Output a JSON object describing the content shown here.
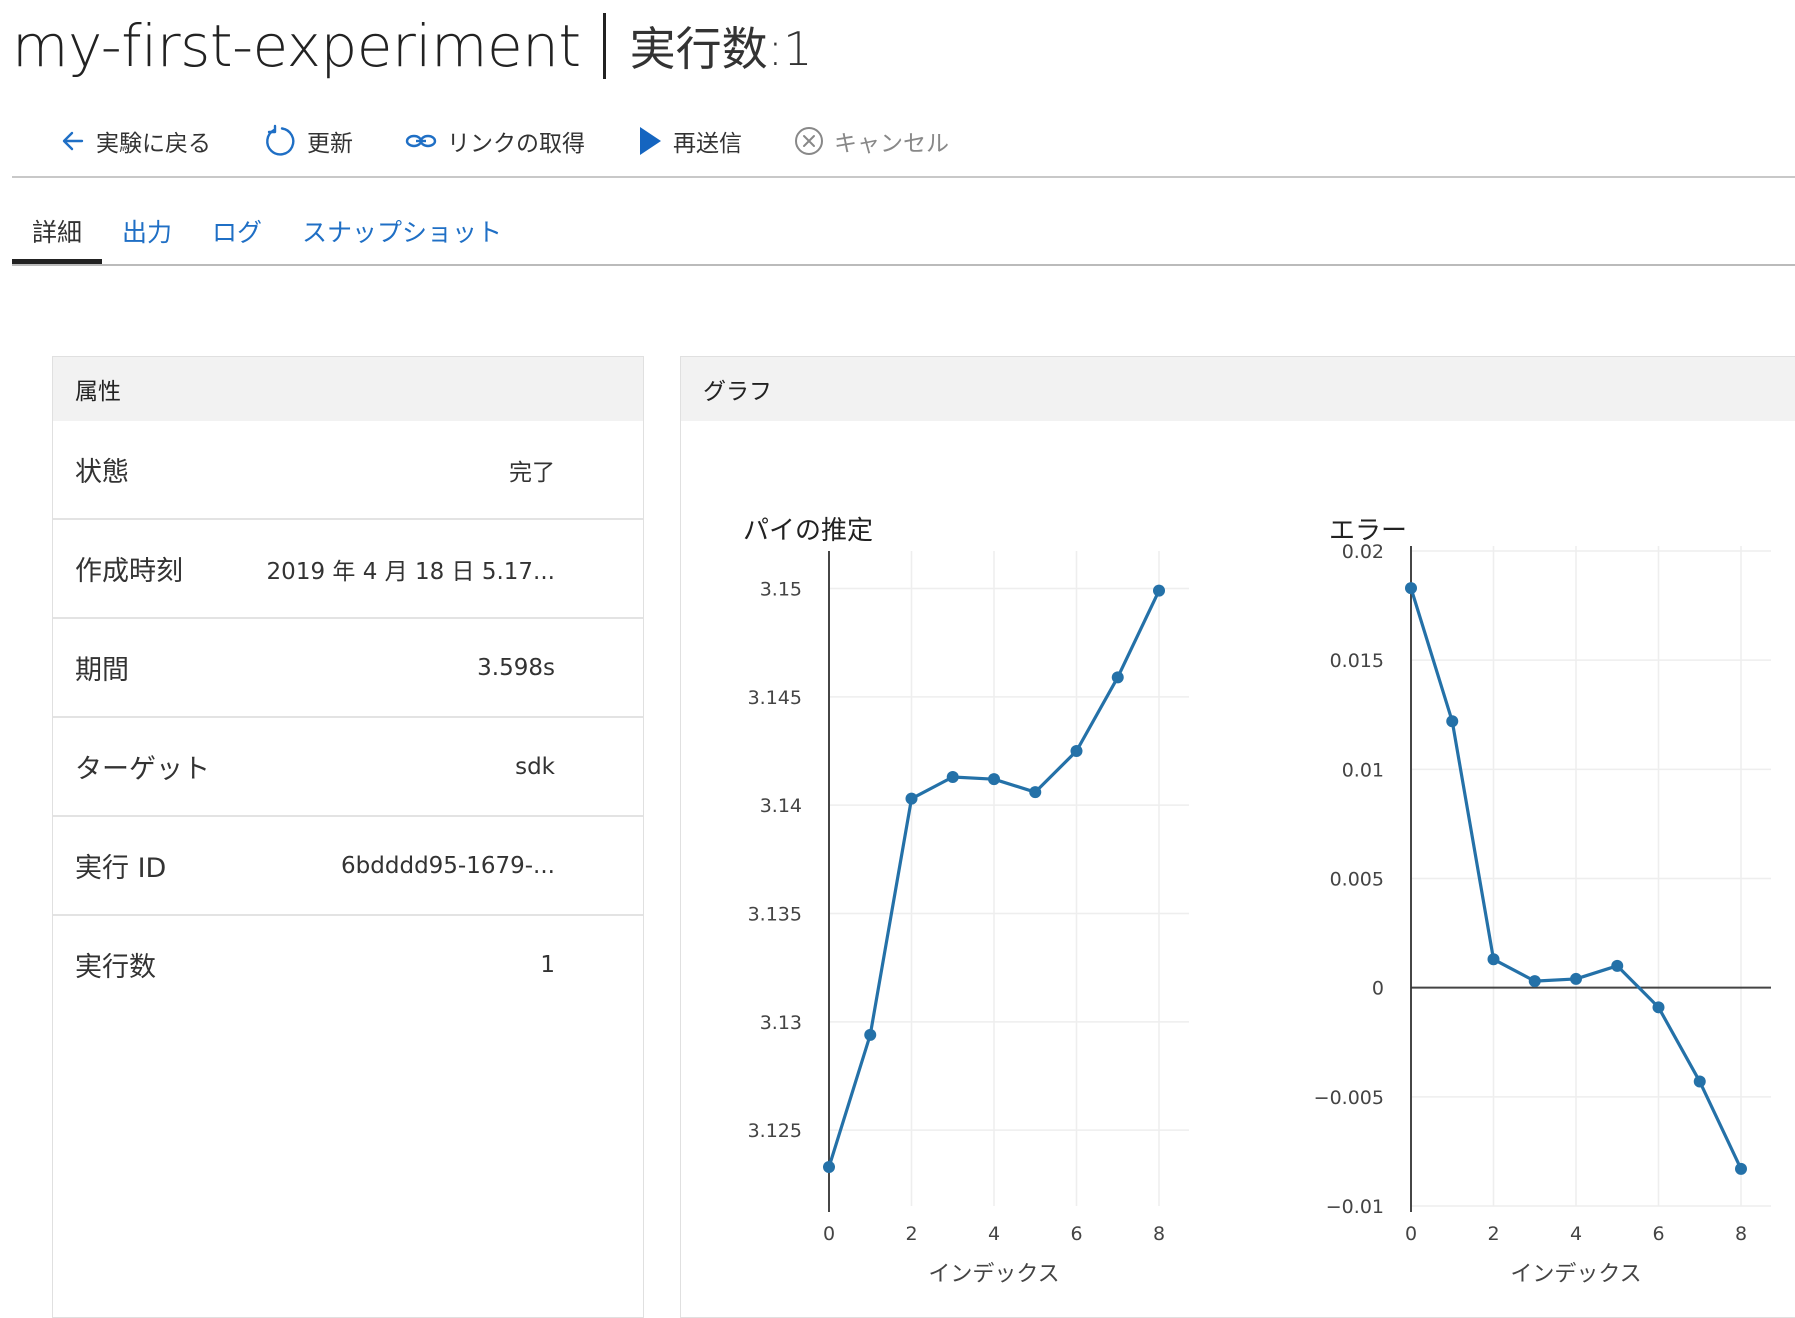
{
  "header": {
    "experiment_name": "my-first-experiment",
    "run_label": "実行数:1"
  },
  "toolbar": {
    "back_label": "実験に戻る",
    "refresh_label": "更新",
    "get_link_label": "リンクの取得",
    "resubmit_label": "再送信",
    "cancel_label": "キャンセル",
    "accent_color": "#1f6fc5",
    "play_color": "#1565c0",
    "disabled_color": "#888888"
  },
  "tabs": [
    {
      "label": "詳細",
      "active": true
    },
    {
      "label": "出力",
      "active": false
    },
    {
      "label": "ログ",
      "active": false
    },
    {
      "label": "スナップショット",
      "active": false
    }
  ],
  "properties": {
    "title": "属性",
    "rows": [
      {
        "label": "状態",
        "value": "完了"
      },
      {
        "label": "作成時刻",
        "value": "2019 年 4 月 18 日 5.17..."
      },
      {
        "label": "期間",
        "value": "3.598s"
      },
      {
        "label": "ターゲット",
        "value": "sdk"
      },
      {
        "label": "実行 ID",
        "value": "6bdddd95-1679-..."
      },
      {
        "label": "実行数",
        "value": "1"
      }
    ]
  },
  "graphs": {
    "title": "グラフ"
  },
  "chart_data": [
    {
      "type": "line",
      "title": "パイの推定",
      "xlabel": "インデックス",
      "ylabel": "",
      "x": [
        0,
        1,
        2,
        3,
        4,
        5,
        6,
        7,
        8
      ],
      "series": [
        {
          "values": [
            3.1233,
            3.1294,
            3.1403,
            3.1413,
            3.1412,
            3.1406,
            3.1425,
            3.1459,
            3.1499
          ]
        }
      ],
      "xlim": [
        0,
        8
      ],
      "ylim": [
        3.1215,
        3.1515
      ],
      "xticks": [
        0,
        2,
        4,
        6,
        8
      ],
      "yticks": [
        3.125,
        3.13,
        3.135,
        3.14,
        3.145,
        3.15
      ],
      "ytick_labels": [
        "3.125",
        "3.13",
        "3.135",
        "3.14",
        "3.145",
        "3.15"
      ],
      "grid": true,
      "color": "#2471a8"
    },
    {
      "type": "line",
      "title": "エラー",
      "xlabel": "インデックス",
      "ylabel": "",
      "x": [
        0,
        1,
        2,
        3,
        4,
        5,
        6,
        7,
        8
      ],
      "series": [
        {
          "values": [
            0.0183,
            0.0122,
            0.0013,
            0.0003,
            0.0004,
            0.001,
            -0.0009,
            -0.0043,
            -0.0083
          ]
        }
      ],
      "xlim": [
        0,
        8
      ],
      "ylim": [
        -0.01,
        0.02
      ],
      "xticks": [
        0,
        2,
        4,
        6,
        8
      ],
      "yticks": [
        -0.01,
        -0.005,
        0,
        0.005,
        0.01,
        0.015,
        0.02
      ],
      "ytick_labels": [
        "−0.01",
        "−0.005",
        "0",
        "0.005",
        "0.01",
        "0.015",
        "0.02"
      ],
      "grid": true,
      "color": "#2471a8"
    }
  ]
}
